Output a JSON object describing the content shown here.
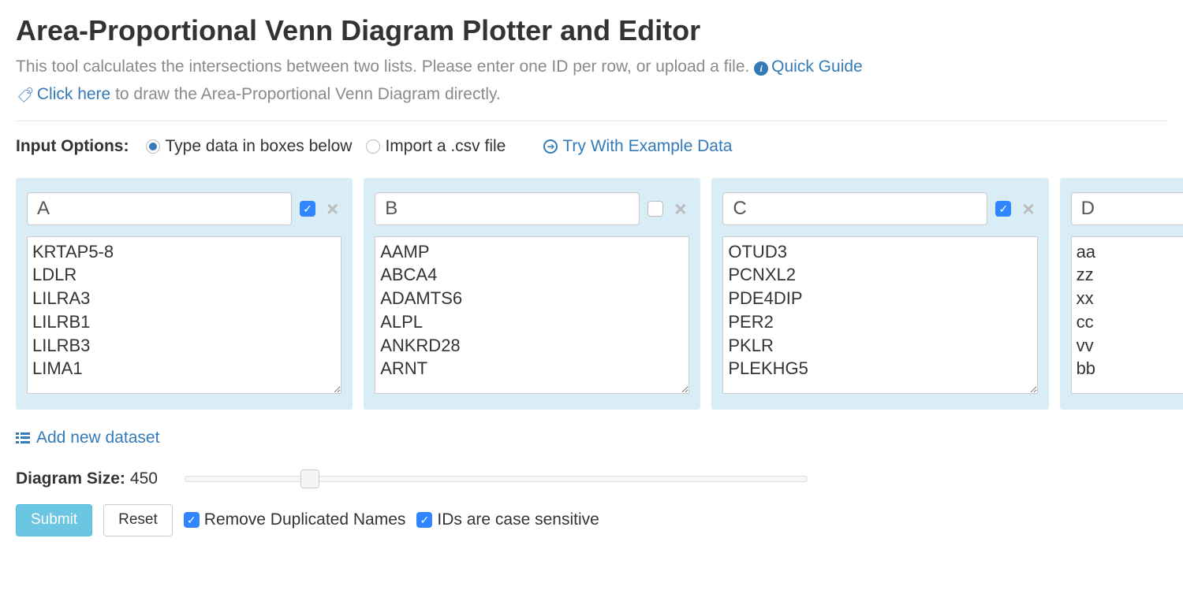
{
  "title": "Area-Proportional Venn Diagram Plotter and Editor",
  "subtitle_plain": "This tool calculates the intersections between two lists. Please enter one ID per row, or upload a file. ",
  "quick_guide": "Quick Guide",
  "click_here": "Click here",
  "click_here_rest": " to draw the Area-Proportional Venn Diagram directly.",
  "input_options_label": "Input Options:",
  "radio_type_label": "Type data in boxes below",
  "radio_import_label": "Import a .csv file",
  "radio_selected": "type",
  "example_link": "Try With Example Data",
  "panels": [
    {
      "name": "A",
      "checked": true,
      "content": "KRTAP5-8\nLDLR\nLILRA3\nLILRB1\nLILRB3\nLIMA1"
    },
    {
      "name": "B",
      "checked": false,
      "content": "AAMP\nABCA4\nADAMTS6\nALPL\nANKRD28\nARNT"
    },
    {
      "name": "C",
      "checked": true,
      "content": "OTUD3\nPCNXL2\nPDE4DIP\nPER2\nPKLR\nPLEKHG5"
    },
    {
      "name": "D",
      "checked": true,
      "content": "aa\nzz\nxx\ncc\nvv\nbb"
    }
  ],
  "add_dataset": "Add new dataset",
  "diagram_size_label": "Diagram Size:",
  "diagram_size_value": "450",
  "slider_percent": 20,
  "submit": "Submit",
  "reset": "Reset",
  "remove_dup_label": "Remove Duplicated Names",
  "remove_dup_checked": true,
  "case_sensitive_label": "IDs are case sensitive",
  "case_sensitive_checked": true
}
